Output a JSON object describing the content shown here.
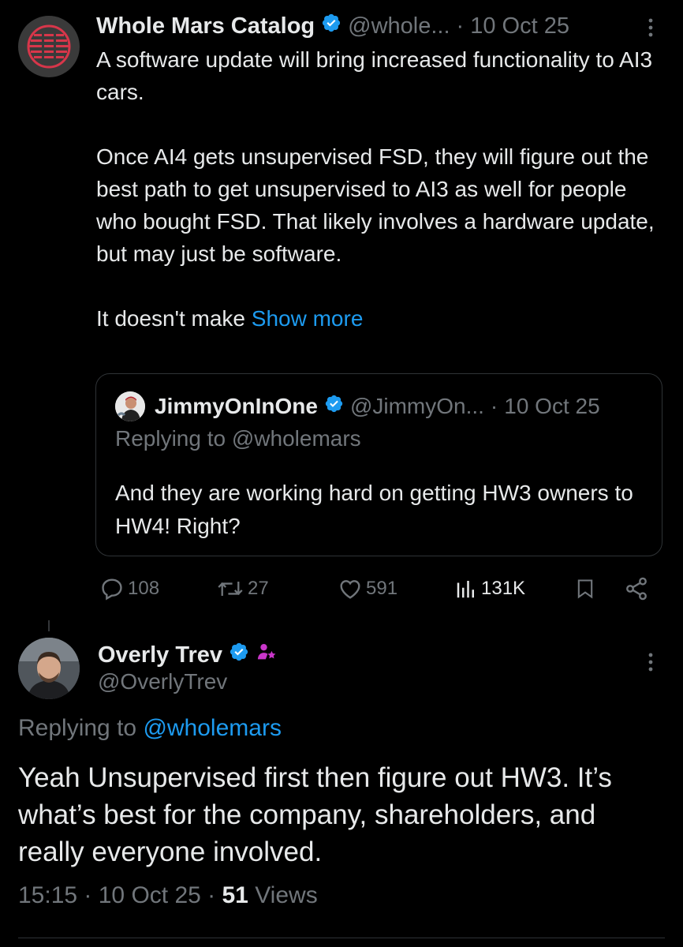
{
  "tweet": {
    "author_name": "Whole Mars Catalog",
    "handle": "@whole...",
    "separator": "·",
    "date": "10 Oct 25",
    "paragraphs": [
      "A software update will bring increased functionality to AI3 cars.",
      "Once AI4 gets unsupervised FSD, they will figure out the best path to get unsupervised to AI3 as well for people who bought FSD. That likely involves a hardware update, but may just be software."
    ],
    "truncated_text": "It doesn't make ",
    "show_more_label": "Show more",
    "quote": {
      "author_name": "JimmyOnInOne",
      "handle": "@JimmyOn...",
      "separator": "·",
      "date": "10 Oct 25",
      "replying_to": "Replying to @wholemars",
      "text": "And they are working hard on getting HW3 owners to HW4! Right?"
    },
    "actions": {
      "replies": "108",
      "reposts": "27",
      "likes": "591",
      "views": "131K"
    }
  },
  "reply": {
    "author_name": "Overly Trev",
    "handle": "@OverlyTrev",
    "replying_prefix": "Replying to ",
    "replying_handle": "@wholemars",
    "text": "Yeah Unsupervised first then figure out HW3. It’s what’s best for the company, shareholders, and really everyone involved.",
    "time": "15:15",
    "separator": " · ",
    "date": "10 Oct 25",
    "views_count": "51",
    "views_label": " Views"
  },
  "colors": {
    "background": "#000000",
    "text": "#e7e9ea",
    "secondary": "#71767b",
    "link": "#1d9bf0",
    "verified": "#1d9bf0",
    "subscriber_badge": "#c936c9"
  },
  "icons": [
    "more-vert-icon",
    "verified-badge-icon",
    "reply-icon",
    "repost-icon",
    "like-icon",
    "views-icon",
    "bookmark-icon",
    "share-icon",
    "subscriber-badge-icon"
  ]
}
